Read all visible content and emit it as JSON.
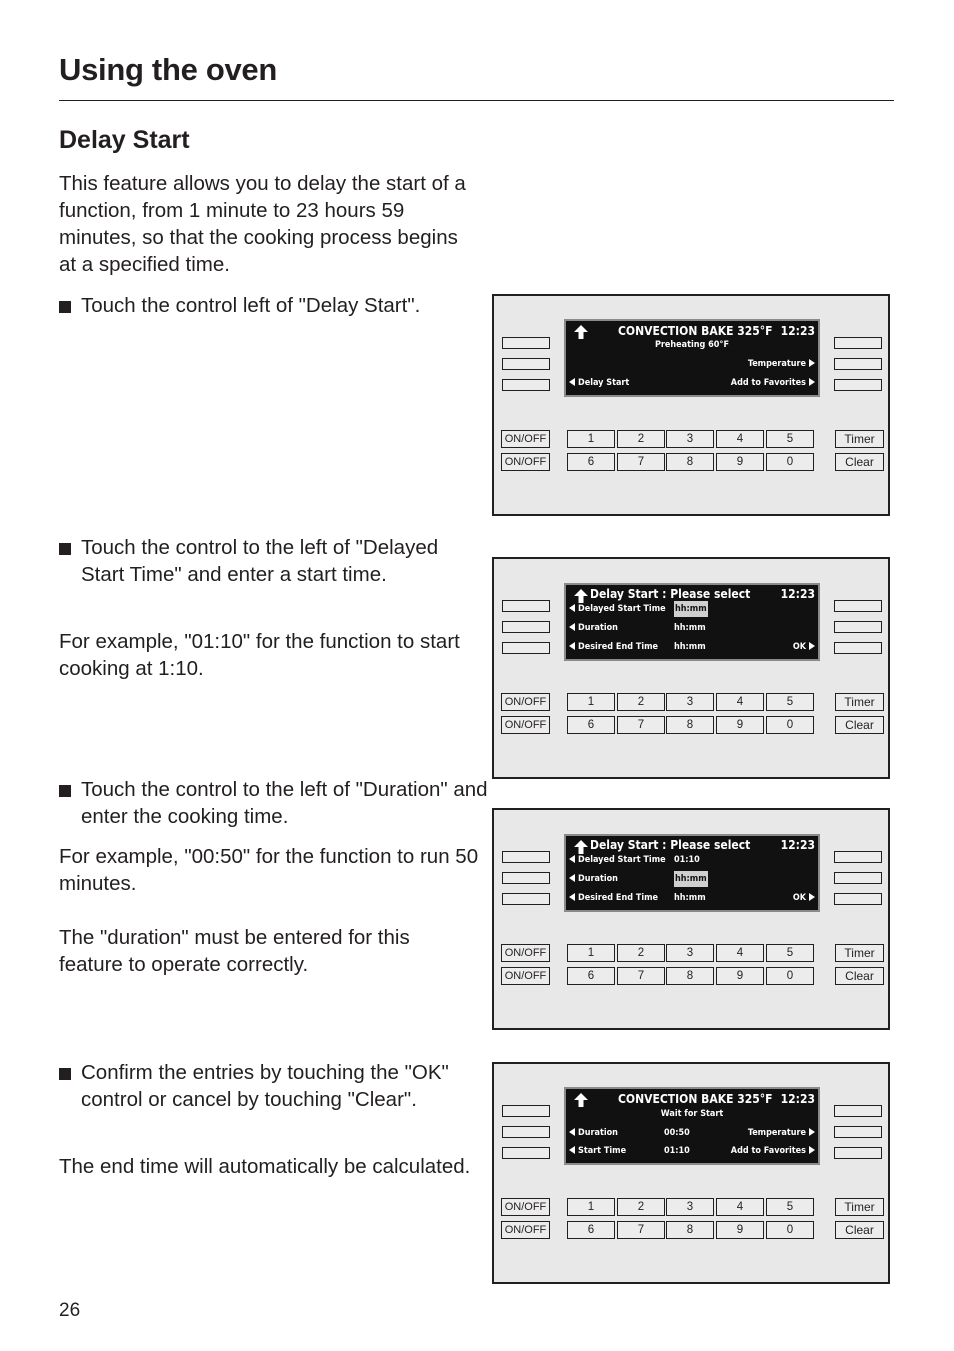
{
  "header": {
    "title": "Using the oven",
    "section_title": "Delay Start"
  },
  "intro": "This feature allows you to delay the start of a function, from 1 minute to 23 hours 59 minutes, so that the cooking process begins at a specified time.",
  "steps": [
    {
      "bullet": "Touch the control left of \"Delay Start\".",
      "notes": []
    },
    {
      "bullet": "Touch the control to the left of \"Delayed Start Time\" and enter a start time.",
      "notes": [
        "For example, \"01:10\" for the function to start cooking at 1:10."
      ]
    },
    {
      "bullet": "Touch the control to the left of \"Duration\" and enter the cooking time.",
      "notes": [
        "For example, \"00:50\" for the function to run 50 minutes.",
        "The \"duration\" must be entered for this feature to operate correctly."
      ]
    },
    {
      "bullet": "Confirm the entries by touching the \"OK\" control or cancel by touching \"Clear\".",
      "notes": [
        "The end time will automatically be calculated."
      ]
    }
  ],
  "keypad": {
    "onoff": "ON/OFF",
    "row1": [
      "1",
      "2",
      "3",
      "4",
      "5"
    ],
    "row2": [
      "6",
      "7",
      "8",
      "9",
      "0"
    ],
    "timer": "Timer",
    "clear": "Clear"
  },
  "screens": [
    {
      "title": "CONVECTION BAKE 325°F",
      "time": "12:23",
      "subtitle": "Preheating 60°F",
      "row2_right": "Temperature",
      "row3_left": "Delay Start",
      "row3_right": "Add to Favorites"
    },
    {
      "title": "Delay Start : Please select",
      "time": "12:23",
      "rows": [
        {
          "label": "Delayed Start Time",
          "value": "hh:mm",
          "highlighted": true
        },
        {
          "label": "Duration",
          "value": "hh:mm",
          "highlighted": false
        },
        {
          "label": "Desired End Time",
          "value": "hh:mm",
          "highlighted": false,
          "right": "OK"
        }
      ]
    },
    {
      "title": "Delay Start : Please select",
      "time": "12:23",
      "rows": [
        {
          "label": "Delayed Start Time",
          "value": "01:10",
          "highlighted": false
        },
        {
          "label": "Duration",
          "value": "hh:mm",
          "highlighted": true
        },
        {
          "label": "Desired End Time",
          "value": "hh:mm",
          "highlighted": false,
          "right": "OK"
        }
      ]
    },
    {
      "title": "CONVECTION BAKE 325°F",
      "time": "12:23",
      "subtitle": "Wait for Start",
      "row2_left": "Duration",
      "row2_mid": "00:50",
      "row2_right": "Temperature",
      "row3_left": "Start Time",
      "row3_mid": "01:10",
      "row3_right": "Add to Favorites"
    }
  ],
  "page_number": "26"
}
